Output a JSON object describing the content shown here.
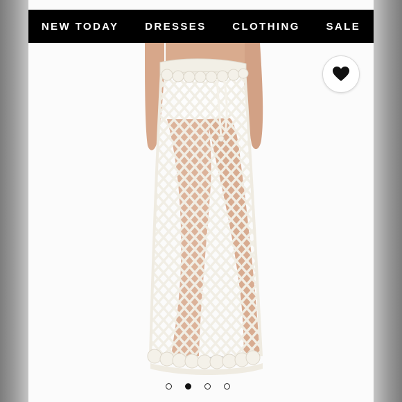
{
  "nav": {
    "items": [
      {
        "label": "NEW TODAY"
      },
      {
        "label": "DRESSES"
      },
      {
        "label": "CLOTHING"
      },
      {
        "label": "SALE"
      }
    ]
  },
  "product": {
    "image_icon": "crochet-maxi-skirt-photo",
    "favorite_icon": "heart-icon"
  },
  "carousel": {
    "total": 4,
    "active_index": 2
  },
  "colors": {
    "nav_background": "#000000",
    "nav_text": "#ffffff",
    "photo_background": "#fbfbfb",
    "crochet": "#f2efe6",
    "skin": "#d7a78a"
  }
}
